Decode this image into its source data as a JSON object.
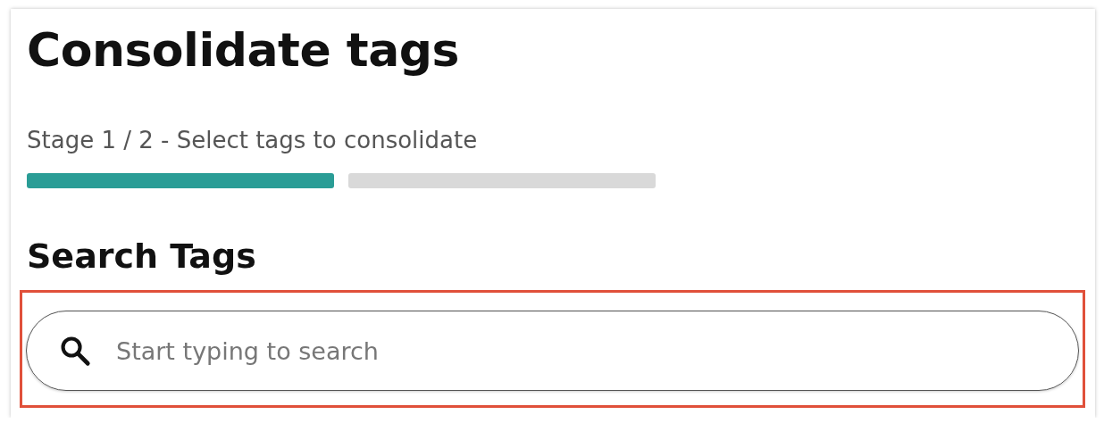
{
  "title": "Consolidate tags",
  "stage": {
    "label": "Stage 1 / 2 - Select tags to consolidate",
    "segments": [
      {
        "complete": true
      },
      {
        "complete": false
      }
    ]
  },
  "search": {
    "heading": "Search Tags",
    "placeholder": "Start typing to search",
    "highlighted": true
  }
}
